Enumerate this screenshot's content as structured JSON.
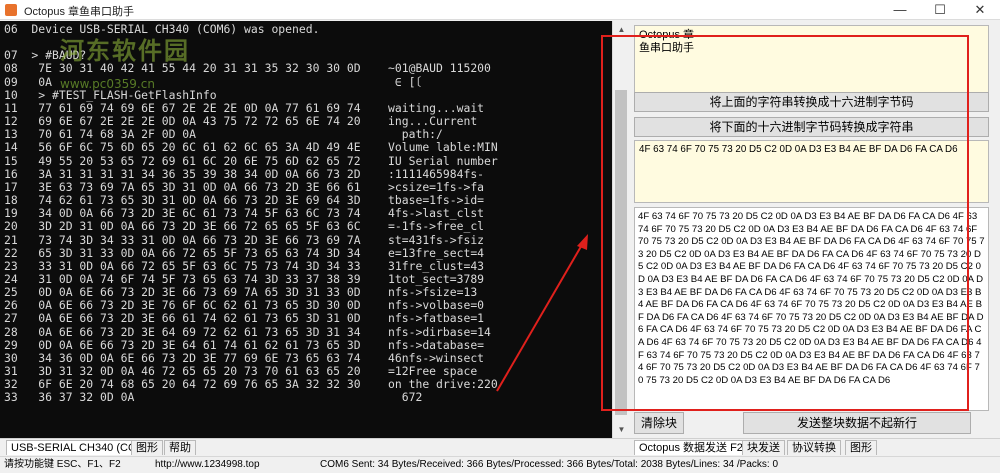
{
  "window": {
    "title": "Octopus 章鱼串口助手",
    "minimize": "—",
    "maximize": "☐",
    "close": "✕"
  },
  "watermark": {
    "site": "河东软件园",
    "url": "www.pc0359.cn"
  },
  "terminal": {
    "lines": [
      "06  Device USB-SERIAL CH340 (COM6) was opened.",
      "",
      "07  > #BAUD?",
      "08   7E 30 31 40 42 41 55 44 20 31 31 35 32 30 30 0D    ~01@BAUD 115200",
      "09   0A                                                  ∈ [〔",
      "10   > #TEST_FLASH-GetFlashInfo",
      "11   77 61 69 74 69 6E 67 2E 2E 2E 0D 0A 77 61 69 74    waiting...wait",
      "12   69 6E 67 2E 2E 2E 0D 0A 43 75 72 72 65 6E 74 20    ing...Current",
      "13   70 61 74 68 3A 2F 0D 0A                              path:/",
      "14   56 6F 6C 75 6D 65 20 6C 61 62 6C 65 3A 4D 49 4E    Volume lable:MIN",
      "15   49 55 20 53 65 72 69 61 6C 20 6E 75 6D 62 65 72    IU Serial number",
      "16   3A 31 31 31 31 34 36 35 39 38 34 0D 0A 66 73 2D    :1111465984fs-",
      "17   3E 63 73 69 7A 65 3D 31 0D 0A 66 73 2D 3E 66 61    >csize=1fs->fa",
      "18   74 62 61 73 65 3D 31 0D 0A 66 73 2D 3E 69 64 3D    tbase=1fs->id=",
      "19   34 0D 0A 66 73 2D 3E 6C 61 73 74 5F 63 6C 73 74    4fs->last_clst",
      "20   3D 2D 31 0D 0A 66 73 2D 3E 66 72 65 65 5F 63 6C    =-1fs->free_cl",
      "21   73 74 3D 34 33 31 0D 0A 66 73 2D 3E 66 73 69 7A    st=431fs->fsiz",
      "22   65 3D 31 33 0D 0A 66 72 65 5F 73 65 63 74 3D 34    e=13fre_sect=4",
      "23   33 31 0D 0A 66 72 65 5F 63 6C 75 73 74 3D 34 33    31fre_clust=43",
      "24   31 0D 0A 74 6F 74 5F 73 65 63 74 3D 33 37 38 39    1tot_sect=3789",
      "25   0D 0A 6E 66 73 2D 3E 66 73 69 7A 65 3D 31 33 0D    nfs->fsize=13",
      "26   0A 6E 66 73 2D 3E 76 6F 6C 62 61 73 65 3D 30 0D    nfs->volbase=0",
      "27   0A 6E 66 73 2D 3E 66 61 74 62 61 73 65 3D 31 0D    nfs->fatbase=1",
      "28   0A 6E 66 73 2D 3E 64 69 72 62 61 73 65 3D 31 34    nfs->dirbase=14",
      "29   0D 0A 6E 66 73 2D 3E 64 61 74 61 62 61 73 65 3D    nfs->database=",
      "30   34 36 0D 0A 6E 66 73 2D 3E 77 69 6E 73 65 63 74    46nfs->winsect",
      "31   3D 31 32 0D 0A 46 72 65 65 20 73 70 61 63 65 20    =12Free space",
      "32   6F 6E 20 74 68 65 20 64 72 69 76 65 3A 32 32 30    on the drive:220",
      "33   36 37 32 0D 0A                                       672"
    ]
  },
  "right_panel": {
    "string_box": "Octopus 章\n鱼串口助手",
    "to_hex_button": "将上面的字符串转换成十六进制字节码",
    "to_string_button": "将下面的十六进制字节码转换成字符串",
    "hex_box": "4F 63 74 6F 70 75 73 20 D5 C2 0D 0A D3 E3 B4 AE BF DA D6 FA CA D6",
    "send_box": "4F 63 74 6F 70 75 73 20 D5 C2 0D 0A D3 E3 B4 AE BF DA D6 FA CA D6 4F 63 74 6F 70 75 73 20 D5 C2 0D 0A D3 E3 B4 AE BF DA D6 FA CA D6 4F 63 74 6F 70 75 73 20 D5 C2 0D 0A D3 E3 B4 AE BF DA D6 FA CA D6 4F 63 74 6F 70 75 73 20 D5 C2 0D 0A D3 E3 B4 AE BF DA D6 FA CA D6 4F 63 74 6F 70 75 73 20 D5 C2 0D 0A D3 E3 B4 AE BF DA D6 FA CA D6 4F 63 74 6F 70 75 73 20 D5 C2 0D 0A D3 E3 B4 AE BF DA D6 FA CA D6 4F 63 74 6F 70 75 73 20 D5 C2 0D 0A D3 E3 B4 AE BF DA D6 FA CA D6 4F 63 74 6F 70 75 73 20 D5 C2 0D 0A D3 E3 B4 AE BF DA D6 FA CA D6 4F 63 74 6F 70 75 73 20 D5 C2 0D 0A D3 E3 B4 AE BF DA D6 FA CA D6 4F 63 74 6F 70 75 73 20 D5 C2 0D 0A D3 E3 B4 AE BF DA D6 FA CA D6 4F 63 74 6F 70 75 73 20 D5 C2 0D 0A D3 E3 B4 AE BF DA D6 FA CA D6 4F 63 74 6F 70 75 73 20 D5 C2 0D 0A D3 E3 B4 AE BF DA D6 FA CA D6 4F 63 74 6F 70 75 73 20 D5 C2 0D 0A D3 E3 B4 AE BF DA D6 FA CA D6 4F 63 74 6F 70 75 73 20 D5 C2 0D 0A D3 E3 B4 AE BF DA D6 FA CA D6 4F 63 74 6F 70 75 73 20 D5 C2 0D 0A D3 E3 B4 AE BF DA D6 FA CA D6",
    "clear_button": "清除块",
    "send_button": "发送整块数据不起新行"
  },
  "tabs_left": [
    "USB-SERIAL CH340 (COM6)",
    "图形",
    "帮助"
  ],
  "tabs_right": [
    "Octopus 数据发送 F2",
    "块发送",
    "协议转换",
    "图形"
  ],
  "status": {
    "hotkeys": "请按功能键 ESC、F1、F2",
    "url": "http://www.1234998.top",
    "stats": "COM6 Sent: 34 Bytes/Received: 366 Bytes/Processed: 366 Bytes/Total: 2038 Bytes/Lines: 34 /Packs: 0"
  },
  "colors": {
    "terminal_bg": "#0c0c0c",
    "terminal_fg": "#d9d9d9",
    "textbox_bg": "#fffbe0",
    "highlight_frame": "#e0201c"
  }
}
